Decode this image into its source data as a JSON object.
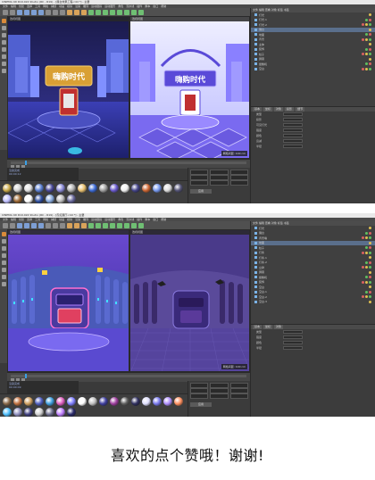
{
  "top_shot": {
    "title": "CINEMA 4D R19.024 Studio (RC - R19) - [展台效果工程.c4d *] - 主要",
    "menu": [
      "文件",
      "编辑",
      "创建",
      "选择",
      "工具",
      "网格",
      "捕捉",
      "动画",
      "模拟",
      "渲染",
      "雕刻",
      "运动跟踪",
      "运动图形",
      "角色",
      "流水线",
      "插件",
      "脚本",
      "窗口",
      "帮助"
    ],
    "viewport_left_label": "透视视图",
    "viewport_right_label": "透视视图",
    "sign_text_left": "嗨购时代",
    "sign_text_right": "嗨购时代",
    "badge": "网格间距: 100 cm",
    "object_manager_header": "文件 编辑 查看 对象 标签 书签",
    "objects": [
      "灯光",
      "灯光.1",
      "灯光.2",
      "展台",
      "地面",
      "背景",
      "主体",
      "装饰",
      "柱子",
      "屏幕",
      "摄像机",
      "空白"
    ],
    "attr_tabs": [
      "基本",
      "坐标",
      "对象",
      "投影",
      "细节"
    ],
    "attr_rows": [
      "类型",
      "投影",
      "可见灯光",
      "强度",
      "颜色",
      "衰减",
      "半径"
    ],
    "console": [
      "渲染完成",
      "00:00:12"
    ],
    "coord_button": "应用",
    "materials": [
      "#c9a94a",
      "#d2d2d2",
      "#e0e0e0",
      "#5b7fd1",
      "#4a4a9a",
      "#8a8ad6",
      "#b0b0b0",
      "#e8c070",
      "#3d6bd6",
      "#a0a0a0",
      "#6a5acd",
      "#f0f0f0",
      "#444488",
      "#cc6633",
      "#7799ee",
      "#dcdcdc",
      "#555577",
      "#c0c0ff",
      "#996633",
      "#ffffff",
      "#2f4f9f",
      "#88aadd",
      "#bbbbbb",
      "#666699"
    ]
  },
  "bottom_shot": {
    "title": "CINEMA 4D R19.024 Studio (RC - R19) - [霓虹展厅.c4d *] - 主要",
    "menu": [
      "文件",
      "编辑",
      "创建",
      "选择",
      "工具",
      "网格",
      "捕捉",
      "动画",
      "模拟",
      "渲染",
      "雕刻",
      "运动跟踪",
      "运动图形",
      "角色",
      "流水线",
      "插件",
      "脚本",
      "窗口",
      "帮助"
    ],
    "viewport_left_label": "透视视图",
    "viewport_right_label": "透视视图",
    "badge": "网格间距: 100 cm",
    "object_manager_header": "文件 编辑 查看 对象 标签 书签",
    "objects": [
      "灯光",
      "展台",
      "背景墙",
      "地面",
      "柱子",
      "灯条",
      "灯条.1",
      "灯条.2",
      "立牌",
      "屏幕",
      "摄像机",
      "装饰",
      "空白",
      "空白.1",
      "空白.2",
      "空白.3"
    ],
    "attr_tabs": [
      "基本",
      "坐标",
      "对象"
    ],
    "attr_rows": [
      "类型",
      "强度",
      "颜色",
      "半径"
    ],
    "console": [
      "渲染完成",
      "00:00:09"
    ],
    "coord_button": "应用",
    "materials": [
      "#8a6a4a",
      "#c07040",
      "#d0a060",
      "#5060c0",
      "#40a0e0",
      "#e060c0",
      "#8080ff",
      "#ffffff",
      "#c0c0c0",
      "#4040a0",
      "#a040a0",
      "#606060",
      "#303060",
      "#e0e0ff",
      "#7a7aee",
      "#b090ff",
      "#ff9060",
      "#50c0ff",
      "#9090c0",
      "#404080",
      "#d0d0d0",
      "#707090",
      "#c080ff",
      "#2a2a6a"
    ]
  },
  "caption": "喜欢的点个赞哦！谢谢!"
}
